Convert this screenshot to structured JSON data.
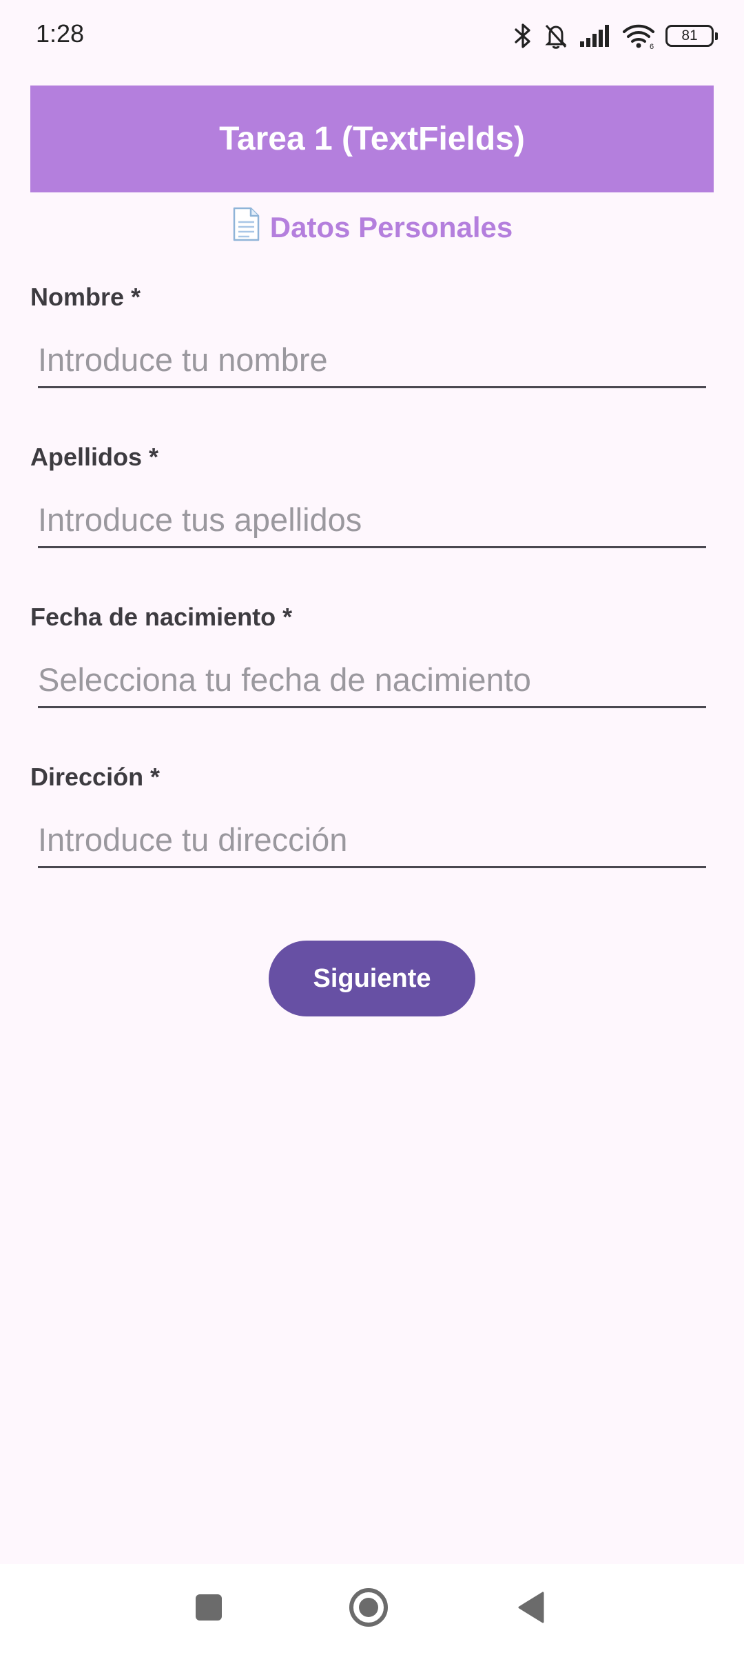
{
  "status_bar": {
    "time": "1:28",
    "battery": "81",
    "icons": [
      "bluetooth-icon",
      "bell-muted-icon",
      "signal-icon",
      "wifi-icon",
      "battery-icon"
    ]
  },
  "app_bar": {
    "title": "Tarea 1 (TextFields)",
    "color": "#B47FDD"
  },
  "section": {
    "icon": "document-icon",
    "title": "Datos Personales"
  },
  "form": {
    "fields": [
      {
        "label": "Nombre *",
        "placeholder": "Introduce tu nombre",
        "value": ""
      },
      {
        "label": "Apellidos *",
        "placeholder": "Introduce tus apellidos",
        "value": ""
      },
      {
        "label": "Fecha de nacimiento *",
        "placeholder": "Selecciona tu fecha de nacimiento",
        "value": ""
      },
      {
        "label": "Dirección *",
        "placeholder": "Introduce tu dirección",
        "value": ""
      }
    ],
    "next_button": "Siguiente",
    "button_color": "#6750A4"
  },
  "nav_bar": {
    "icons": [
      "recents-square-icon",
      "home-circle-icon",
      "back-triangle-icon"
    ]
  }
}
